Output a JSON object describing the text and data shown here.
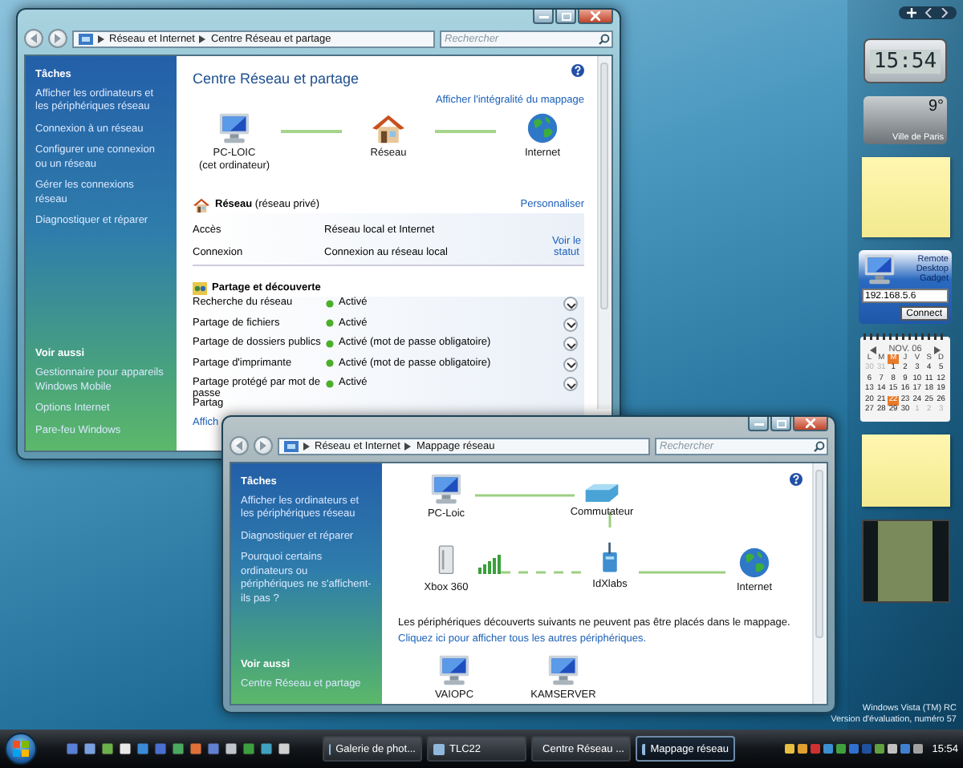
{
  "desktop": {
    "notice": [
      "Windows Vista (TM) RC",
      "Version d'évaluation, numéro 57"
    ]
  },
  "network_center_window": {
    "breadcrumb": [
      "Réseau et Internet",
      "Centre Réseau et partage"
    ],
    "search": {
      "placeholder": "Rechercher"
    },
    "sidebar": {
      "tasks_title": "Tâches",
      "tasks": [
        "Afficher les ordinateurs et les périphériques réseau",
        "Connexion à un réseau",
        "Configurer une connexion ou un réseau",
        "Gérer les connexions réseau",
        "Diagnostiquer et réparer"
      ],
      "see_also_title": "Voir aussi",
      "see_also": [
        "Gestionnaire pour appareils Windows Mobile",
        "Options Internet",
        "Pare-feu Windows"
      ]
    },
    "title": "Centre Réseau et partage",
    "full_map_link": "Afficher l'intégralité du mappage",
    "map_nodes": [
      {
        "kind": "computer",
        "label": "PC-LOIC",
        "sublabel": "(cet ordinateur)"
      },
      {
        "kind": "house",
        "label": "Réseau"
      },
      {
        "kind": "globe",
        "label": "Internet"
      }
    ],
    "network": {
      "name": "**Réseau** (réseau privé)",
      "customize_link": "Personnaliser",
      "rows": [
        {
          "label": "Accès",
          "value": "Réseau local et Internet"
        },
        {
          "label": "Connexion",
          "value": "Connexion au réseau local",
          "link": "Voir le statut"
        }
      ]
    },
    "sharing": {
      "title": "Partage et découverte",
      "rows": [
        {
          "label": "Recherche du réseau",
          "status": "Activé"
        },
        {
          "label": "Partage de fichiers",
          "status": "Activé"
        },
        {
          "label": "Partage de dossiers publics",
          "status": "Activé (mot de passe obligatoire)"
        },
        {
          "label": "Partage d'imprimante",
          "status": "Activé (mot de passe obligatoire)"
        },
        {
          "label": "Partage protégé par mot de passe",
          "status": "Activé"
        },
        {
          "label": "Partag"
        }
      ]
    },
    "bottom_link": "Affich"
  },
  "map_window": {
    "breadcrumb": [
      "Réseau et Internet",
      "Mappage réseau"
    ],
    "search": {
      "placeholder": "Rechercher"
    },
    "sidebar": {
      "tasks_title": "Tâches",
      "tasks": [
        "Afficher les ordinateurs et les périphériques réseau",
        "Diagnostiquer et réparer",
        "Pourquoi certains ordinateurs ou périphériques ne s'affichent-ils pas ?"
      ],
      "see_also_title": "Voir aussi",
      "see_also": [
        "Centre Réseau et partage"
      ]
    },
    "map_nodes": [
      {
        "kind": "computer",
        "label": "PC-Loic"
      },
      {
        "kind": "switch",
        "label": "Commutateur"
      },
      {
        "kind": "xbox",
        "label": "Xbox 360"
      },
      {
        "kind": "router",
        "label": "IdXlabs"
      },
      {
        "kind": "globe",
        "label": "Internet"
      }
    ],
    "unplaced_note": "Les périphériques découverts suivants ne peuvent pas être placés dans le mappage.",
    "show_all_link": "Cliquez ici pour afficher tous les autres périphériques.",
    "unplaced_devices": [
      {
        "kind": "computer",
        "label": "VAIOPC"
      },
      {
        "kind": "computer",
        "label": "KAMSERVER"
      }
    ]
  },
  "gadgets": {
    "clock": "15:54",
    "weather": {
      "temperature": "9°",
      "city": "Ville de Paris"
    },
    "remote_desktop": {
      "title": "Remote Desktop Gadget",
      "address": "192.168.5.6",
      "button": "Connect"
    },
    "calendar": {
      "month": "NOV. 06",
      "weekdays": [
        {
          "label": "L",
          "selected": false
        },
        {
          "label": "M",
          "selected": false
        },
        {
          "label": "M",
          "selected": true
        },
        {
          "label": "J",
          "selected": false
        },
        {
          "label": "V",
          "selected": false
        },
        {
          "label": "S",
          "selected": false
        },
        {
          "label": "D",
          "selected": false
        }
      ],
      "days": [
        {
          "label": "30",
          "outside": true,
          "selected": false
        },
        {
          "label": "31",
          "outside": true,
          "selected": false
        },
        {
          "label": "1",
          "outside": false,
          "selected": false
        },
        {
          "label": "2",
          "outside": false,
          "selected": false
        },
        {
          "label": "3",
          "outside": false,
          "selected": false
        },
        {
          "label": "4",
          "outside": false,
          "selected": false
        },
        {
          "label": "5",
          "outside": false,
          "selected": false
        },
        {
          "label": "6",
          "outside": false,
          "selected": false
        },
        {
          "label": "7",
          "outside": false,
          "selected": false
        },
        {
          "label": "8",
          "outside": false,
          "selected": false
        },
        {
          "label": "9",
          "outside": false,
          "selected": false
        },
        {
          "label": "10",
          "outside": false,
          "selected": false
        },
        {
          "label": "11",
          "outside": false,
          "selected": false
        },
        {
          "label": "12",
          "outside": false,
          "selected": false
        },
        {
          "label": "13",
          "outside": false,
          "selected": false
        },
        {
          "label": "14",
          "outside": false,
          "selected": false
        },
        {
          "label": "15",
          "outside": false,
          "selected": false
        },
        {
          "label": "16",
          "outside": false,
          "selected": false
        },
        {
          "label": "17",
          "outside": false,
          "selected": false
        },
        {
          "label": "18",
          "outside": false,
          "selected": false
        },
        {
          "label": "19",
          "outside": false,
          "selected": false
        },
        {
          "label": "20",
          "outside": false,
          "selected": false
        },
        {
          "label": "21",
          "outside": false,
          "selected": false
        },
        {
          "label": "22",
          "outside": false,
          "selected": true
        },
        {
          "label": "23",
          "outside": false,
          "selected": false
        },
        {
          "label": "24",
          "outside": false,
          "selected": false
        },
        {
          "label": "25",
          "outside": false,
          "selected": false
        },
        {
          "label": "26",
          "outside": false,
          "selected": false
        },
        {
          "label": "27",
          "outside": false,
          "selected": false
        },
        {
          "label": "28",
          "outside": false,
          "selected": false
        },
        {
          "label": "29",
          "outside": false,
          "selected": false
        },
        {
          "label": "30",
          "outside": false,
          "selected": false
        },
        {
          "label": "1",
          "outside": true,
          "selected": false
        },
        {
          "label": "2",
          "outside": true,
          "selected": false
        },
        {
          "label": "3",
          "outside": true,
          "selected": false
        }
      ]
    }
  },
  "taskbar": {
    "tasks": [
      {
        "label": "Galerie de phot...",
        "selected": false
      },
      {
        "label": "TLC22",
        "selected": false
      },
      {
        "label": "Centre Réseau ...",
        "selected": false
      },
      {
        "label": "Mappage réseau",
        "selected": true
      }
    ],
    "clock": "15:54"
  }
}
